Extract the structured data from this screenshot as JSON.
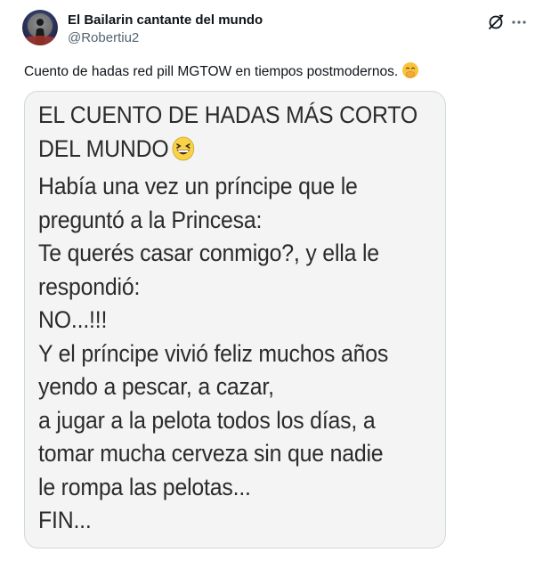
{
  "author": {
    "name": "El Bailarin cantante del mundo",
    "handle": "@Robertiu2"
  },
  "tweet": {
    "text": "Cuento de hadas red pill MGTOW en tiempos postmodernos.",
    "emoji": "face-with-hand-over-mouth"
  },
  "header_icons": {
    "grok": "grok-icon",
    "more": "more-icon"
  },
  "meme": {
    "lines": [
      "EL CUENTO DE HADAS MÁS CORTO",
      "DEL MUNDO",
      "Había una vez un príncipe que le",
      "preguntó a la Princesa:",
      "Te querés casar conmigo?, y ella le",
      "respondió:",
      "NO...!!!",
      "Y el príncipe vivió feliz muchos años",
      "yendo a pescar, a cazar,",
      "a jugar a la pelota todos los días, a",
      "tomar mucha cerveza sin que nadie",
      "le rompa las pelotas...",
      "FIN..."
    ],
    "emoji": "grinning-squinting-face"
  },
  "colors": {
    "text": "#0f1419",
    "secondary": "#536471",
    "border": "#cfd9de",
    "meme_bg": "#f4f4f4",
    "meme_text": "#2b2b2b"
  }
}
